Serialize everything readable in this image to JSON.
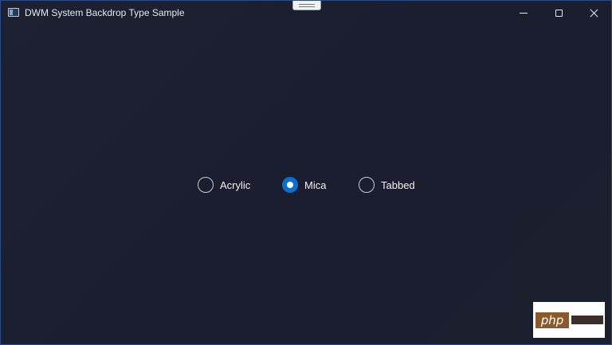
{
  "window": {
    "title": "DWM System Backdrop Type Sample",
    "controls": {
      "minimize_icon": "minimize-icon",
      "maximize_icon": "maximize-icon",
      "close_icon": "close-icon"
    }
  },
  "backdrop": {
    "options": [
      {
        "label": "Acrylic",
        "checked": false
      },
      {
        "label": "Mica",
        "checked": true
      },
      {
        "label": "Tabbed",
        "checked": false
      }
    ]
  },
  "watermark": {
    "brand": "php"
  },
  "colors": {
    "accent": "#0a6fd1",
    "background": "#1a1d2b",
    "window_border": "#2b4a8a"
  }
}
